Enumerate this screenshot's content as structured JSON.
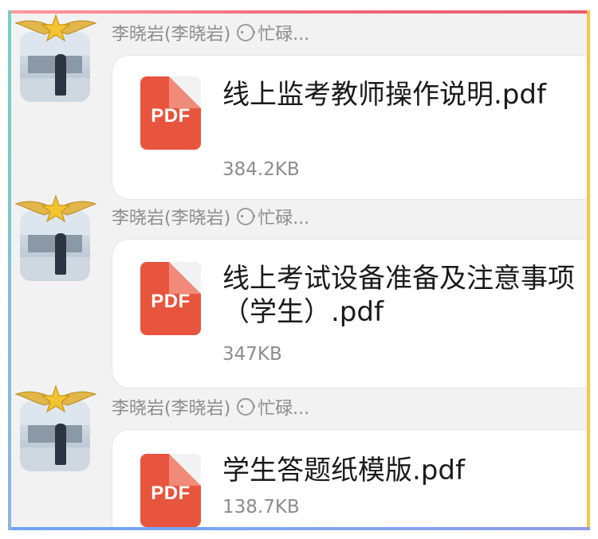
{
  "messages": [
    {
      "sender": "李晓岩(李晓岩)",
      "status": "忙碌...",
      "file": {
        "type_label": "PDF",
        "name": "线上监考教师操作说明.pdf",
        "size": "384.2KB"
      }
    },
    {
      "sender": "李晓岩(李晓岩)",
      "status": "忙碌...",
      "file": {
        "type_label": "PDF",
        "name": "线上考试设备准备及注意事项（学生）.pdf",
        "size": "347KB"
      }
    },
    {
      "sender": "李晓岩(李晓岩)",
      "status": "忙碌...",
      "file": {
        "type_label": "PDF",
        "name": "学生答题纸模版.pdf",
        "size": "138.7KB"
      }
    }
  ],
  "colors": {
    "pdf_red": "#e8553e",
    "frame_top": "#f06a7a",
    "frame_right": "#f5c64a",
    "frame_bottom": "#7ea6f0",
    "frame_left": "#74d0c3"
  }
}
